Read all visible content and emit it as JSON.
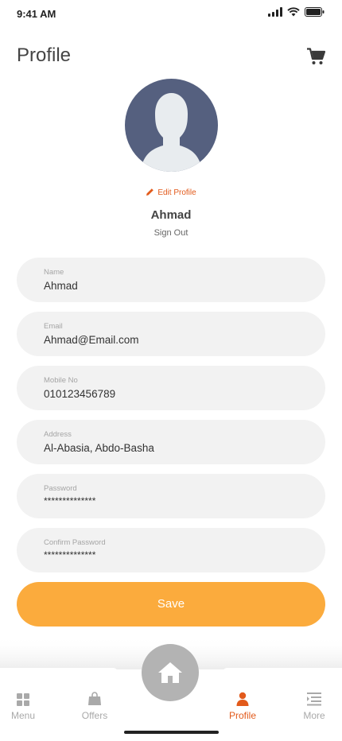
{
  "status": {
    "time": "9:41 AM"
  },
  "header": {
    "title": "Profile"
  },
  "profile": {
    "edit_label": "Edit Profile",
    "name": "Ahmad",
    "sign_out": "Sign Out"
  },
  "fields": [
    {
      "label": "Name",
      "value": "Ahmad"
    },
    {
      "label": "Email",
      "value": "Ahmad@Email.com"
    },
    {
      "label": "Mobile No",
      "value": "010123456789"
    },
    {
      "label": "Address",
      "value": "Al-Abasia, Abdo-Basha"
    },
    {
      "label": "Password",
      "value": "**************"
    },
    {
      "label": "Confirm Password",
      "value": "**************"
    }
  ],
  "save_label": "Save",
  "nav": {
    "items": [
      {
        "label": "Menu",
        "icon": "grid-icon"
      },
      {
        "label": "Offers",
        "icon": "bag-icon"
      },
      {
        "label": "Profile",
        "icon": "person-icon",
        "active": true
      },
      {
        "label": "More",
        "icon": "list-icon"
      }
    ],
    "home_icon": "home-icon"
  },
  "colors": {
    "accent": "#e25a1b",
    "button": "#fbab3d",
    "avatar_bg": "#55607f",
    "field_bg": "#f2f2f2",
    "inactive": "#a9a9a9"
  }
}
